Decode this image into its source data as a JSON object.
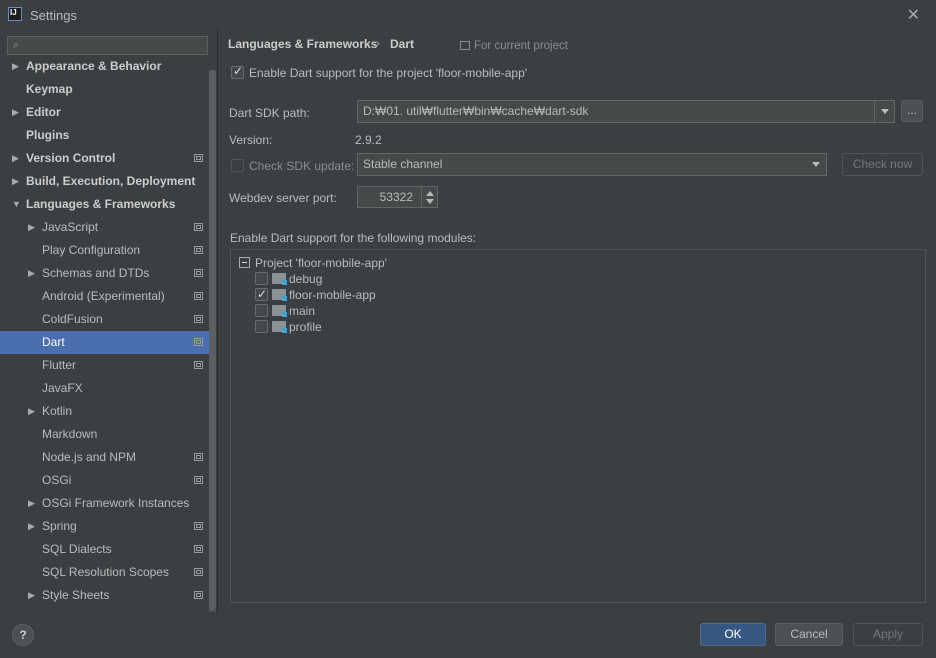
{
  "window": {
    "title": "Settings"
  },
  "search": {
    "placeholder": ""
  },
  "sidebar": {
    "items": [
      {
        "label": "Appearance & Behavior",
        "level": 0,
        "expandable": true,
        "expanded": false,
        "project_icon": false
      },
      {
        "label": "Keymap",
        "level": 0,
        "expandable": false,
        "project_icon": false
      },
      {
        "label": "Editor",
        "level": 0,
        "expandable": true,
        "expanded": false,
        "project_icon": false
      },
      {
        "label": "Plugins",
        "level": 0,
        "expandable": false,
        "project_icon": false
      },
      {
        "label": "Version Control",
        "level": 0,
        "expandable": true,
        "expanded": false,
        "project_icon": true
      },
      {
        "label": "Build, Execution, Deployment",
        "level": 0,
        "expandable": true,
        "expanded": false,
        "project_icon": false
      },
      {
        "label": "Languages & Frameworks",
        "level": 0,
        "expandable": true,
        "expanded": true,
        "project_icon": false
      },
      {
        "label": "JavaScript",
        "level": 1,
        "expandable": true,
        "expanded": false,
        "project_icon": true
      },
      {
        "label": "Play Configuration",
        "level": 1,
        "expandable": false,
        "project_icon": true
      },
      {
        "label": "Schemas and DTDs",
        "level": 1,
        "expandable": true,
        "expanded": false,
        "project_icon": true
      },
      {
        "label": "Android (Experimental)",
        "level": 1,
        "expandable": false,
        "project_icon": true
      },
      {
        "label": "ColdFusion",
        "level": 1,
        "expandable": false,
        "project_icon": true
      },
      {
        "label": "Dart",
        "level": 1,
        "expandable": false,
        "project_icon": true,
        "selected": true
      },
      {
        "label": "Flutter",
        "level": 1,
        "expandable": false,
        "project_icon": true
      },
      {
        "label": "JavaFX",
        "level": 1,
        "expandable": false,
        "project_icon": false
      },
      {
        "label": "Kotlin",
        "level": 1,
        "expandable": true,
        "expanded": false,
        "project_icon": false
      },
      {
        "label": "Markdown",
        "level": 1,
        "expandable": false,
        "project_icon": false
      },
      {
        "label": "Node.js and NPM",
        "level": 1,
        "expandable": false,
        "project_icon": true
      },
      {
        "label": "OSGi",
        "level": 1,
        "expandable": false,
        "project_icon": true
      },
      {
        "label": "OSGi Framework Instances",
        "level": 1,
        "expandable": true,
        "expanded": false,
        "project_icon": false
      },
      {
        "label": "Spring",
        "level": 1,
        "expandable": true,
        "expanded": false,
        "project_icon": true
      },
      {
        "label": "SQL Dialects",
        "level": 1,
        "expandable": false,
        "project_icon": true
      },
      {
        "label": "SQL Resolution Scopes",
        "level": 1,
        "expandable": false,
        "project_icon": true
      },
      {
        "label": "Style Sheets",
        "level": 1,
        "expandable": true,
        "expanded": false,
        "project_icon": true
      }
    ]
  },
  "breadcrumb": {
    "parent": "Languages & Frameworks",
    "separator": "›",
    "current": "Dart",
    "scope": "For current project"
  },
  "dart": {
    "enable_label": "Enable Dart support for the project 'floor-mobile-app'",
    "enable_checked": true,
    "sdk_path_label": "Dart SDK path:",
    "sdk_path_value": "D:₩01. util₩flutter₩bin₩cache₩dart-sdk",
    "browse_label": "...",
    "version_label": "Version:",
    "version_value": "2.9.2",
    "check_update_label": "Check SDK update:",
    "check_update_checked": false,
    "channel_value": "Stable channel",
    "check_now_label": "Check now",
    "port_label": "Webdev server port:",
    "port_value": "53322",
    "modules_label": "Enable Dart support for the following modules:",
    "project_node": "Project 'floor-mobile-app'",
    "modules": [
      {
        "name": "debug",
        "checked": false
      },
      {
        "name": "floor-mobile-app",
        "checked": true
      },
      {
        "name": "main",
        "checked": false
      },
      {
        "name": "profile",
        "checked": false
      }
    ]
  },
  "footer": {
    "help": "?",
    "ok": "OK",
    "cancel": "Cancel",
    "apply": "Apply"
  },
  "colors": {
    "background": "#3c3f41",
    "selection": "#4b6eaf",
    "primary_button": "#365880",
    "module_badge": "#3ba6d9"
  }
}
